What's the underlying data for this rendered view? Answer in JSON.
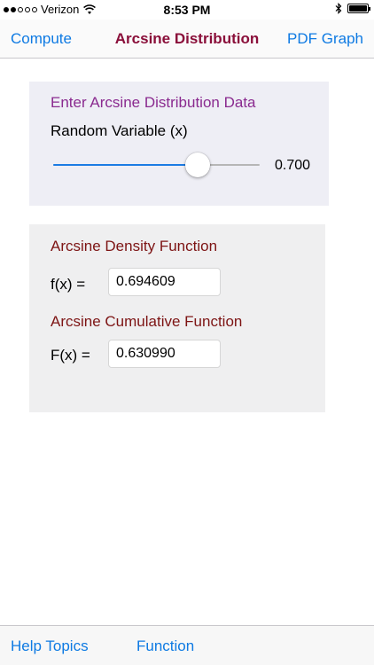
{
  "status_bar": {
    "carrier": "Verizon",
    "time": "8:53 PM",
    "signal_dots": [
      true,
      true,
      false,
      false,
      false
    ]
  },
  "nav": {
    "left_label": "Compute",
    "title": "Arcsine Distribution",
    "right_label": "PDF Graph"
  },
  "input": {
    "heading": "Enter Arcsine Distribution Data",
    "variable_label": "Random Variable (x)",
    "slider_value": 0.7,
    "slider_min": 0,
    "slider_max": 1,
    "slider_display": "0.700"
  },
  "output": {
    "density_heading": "Arcsine Density Function",
    "density_label": "f(x) =",
    "density_value": "0.694609",
    "cumulative_heading": "Arcsine Cumulative Function",
    "cumulative_label": "F(x) =",
    "cumulative_value": "0.630990"
  },
  "toolbar": {
    "help_label": "Help Topics",
    "function_label": "Function"
  },
  "colors": {
    "accent_blue": "#0e7ae3",
    "title_maroon": "#8a0f3a",
    "heading_purple": "#8a2a8f",
    "heading_red": "#7d1414"
  }
}
